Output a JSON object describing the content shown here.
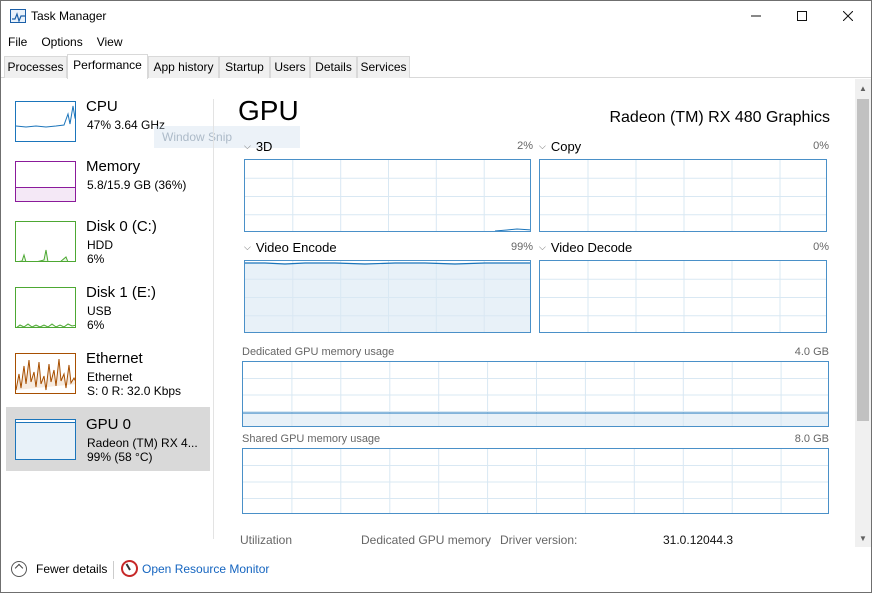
{
  "window": {
    "title": "Task Manager"
  },
  "menu": [
    "File",
    "Options",
    "View"
  ],
  "tabs": [
    "Processes",
    "Performance",
    "App history",
    "Startup",
    "Users",
    "Details",
    "Services"
  ],
  "active_tab": "Performance",
  "ghost_overlay": "Window Snip",
  "resources": [
    {
      "name": "CPU",
      "line1": "47% 3.64 GHz",
      "line2": "",
      "color": "#1b75bb"
    },
    {
      "name": "Memory",
      "line1": "5.8/15.9 GB (36%)",
      "line2": "",
      "color": "#8b1a9b"
    },
    {
      "name": "Disk 0 (C:)",
      "line1": "HDD",
      "line2": "6%",
      "color": "#4da833"
    },
    {
      "name": "Disk 1 (E:)",
      "line1": "USB",
      "line2": "6%",
      "color": "#4da833"
    },
    {
      "name": "Ethernet",
      "line1": "Ethernet",
      "line2": "S: 0 R: 32.0 Kbps",
      "color": "#a74f01"
    },
    {
      "name": "GPU 0",
      "line1": "Radeon (TM) RX 4...",
      "line2": "99% (58 °C)",
      "color": "#1b75bb",
      "selected": true
    }
  ],
  "detail": {
    "title": "GPU",
    "model": "Radeon (TM) RX 480 Graphics",
    "engines": [
      {
        "label": "3D",
        "percent": "2%"
      },
      {
        "label": "Copy",
        "percent": "0%"
      },
      {
        "label": "Video Encode",
        "percent": "99%"
      },
      {
        "label": "Video Decode",
        "percent": "0%"
      }
    ],
    "dedicated_label": "Dedicated GPU memory usage",
    "dedicated_max": "4.0 GB",
    "shared_label": "Shared GPU memory usage",
    "shared_max": "8.0 GB",
    "stats": {
      "utilization_label": "Utilization",
      "dedicated_label": "Dedicated GPU memory",
      "driver_label": "Driver version:",
      "driver_value": "31.0.12044.3"
    }
  },
  "footer": {
    "fewer_details": "Fewer details",
    "resource_monitor": "Open Resource Monitor"
  },
  "colors": {
    "graph_border": "#4a90c8",
    "graph_grid": "#d9e8f3",
    "link": "#1565c0",
    "selected_bg": "#d9d9d9"
  }
}
